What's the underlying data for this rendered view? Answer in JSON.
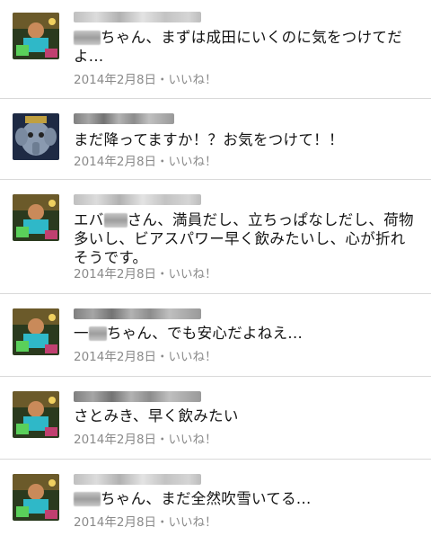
{
  "comments": [
    {
      "text_after_redaction": "ちゃん、まずは成田にいくのに気をつけてだよ...",
      "date": "2014年2月8日",
      "separator": "・",
      "like_label": "いいね！"
    },
    {
      "text": "まだ降ってますか！？お気をつけて！！",
      "date": "2014年2月8日",
      "separator": "・",
      "like_label": "いいね！"
    },
    {
      "text_before_redaction": "エバ",
      "text_after_redaction": "さん、満員だし、立ちっぱなしだし、荷物多いし、ビアスパワー早く飲みたいし、心が折れそうです。",
      "date": "2014年2月8日",
      "separator": "・",
      "like_label": "いいね！"
    },
    {
      "text_before_redaction": "一",
      "text_after_redaction": "ちゃん、でも安心だよねえ...",
      "date": "2014年2月8日",
      "separator": "・",
      "like_label": "いいね！"
    },
    {
      "text": "さとみき、早く飲みたい",
      "date": "2014年2月8日",
      "separator": "・",
      "like_label": "いいね！"
    },
    {
      "text_after_redaction": "ちゃん、まだ全然吹雪いてる...",
      "date": "2014年2月8日",
      "separator": "・",
      "like_label": "いいね！"
    }
  ]
}
